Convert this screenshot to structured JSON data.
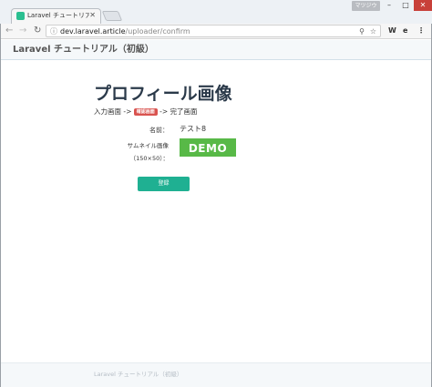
{
  "browser": {
    "tab_title": "Laravel チュートリアル",
    "tab_close": "✕",
    "user_badge": "マツジウ",
    "window_buttons": {
      "minimize": "–",
      "maximize": "□",
      "close": "✕"
    },
    "url_host": "dev.laravel.article",
    "url_path": "/uploader/confirm",
    "extensions": [
      "W",
      "e"
    ]
  },
  "navbar": {
    "brand": "Laravel チュートリアル（初級）"
  },
  "page": {
    "heading": "プロフィール画像",
    "steps": {
      "step1": "入力画面 ->",
      "step2_active": "確認画面",
      "step3": "-> 完了画面"
    },
    "form": {
      "name_label": "名前：",
      "name_value": "テスト8",
      "thumbnail_label": "サムネイル画像",
      "thumbnail_size": "（150×50）：",
      "thumbnail_image_text": "DEMO",
      "submit_label": "登録"
    }
  },
  "footer": {
    "text": "Laravel チュートリアル（初級）"
  },
  "colors": {
    "accent": "#1fb092",
    "badge": "#d9534f",
    "thumbnail": "#58b947",
    "heading": "#2b3a4a"
  }
}
